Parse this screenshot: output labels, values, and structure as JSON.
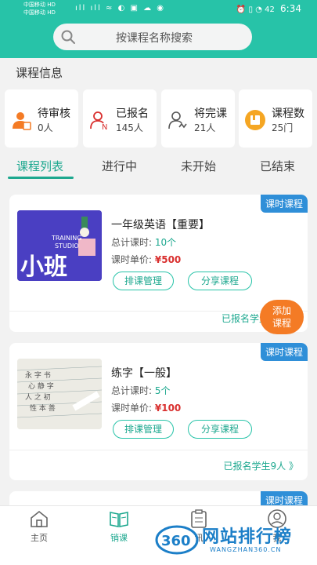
{
  "status": {
    "carrier1": "中国移动 HD",
    "carrier2": "中国移动 HD",
    "signal": "ıll ıll ≈ ◐ ▣ ☁ ◉",
    "right_icons": "⏰ ▯ ◔",
    "battery": "42",
    "time": "6:34"
  },
  "search": {
    "placeholder": "按课程名称搜索"
  },
  "section_title": "课程信息",
  "stats": [
    {
      "label": "待审核",
      "value": "0人",
      "icon": "person-review-icon",
      "color": "#f47b25"
    },
    {
      "label": "已报名",
      "value": "145人",
      "icon": "person-enrolled-icon",
      "color": "#d9302f"
    },
    {
      "label": "将完课",
      "value": "21人",
      "icon": "person-complete-icon",
      "color": "#555555"
    },
    {
      "label": "课程数",
      "value": "25门",
      "icon": "book-count-icon",
      "color": "#f5a623"
    }
  ],
  "tabs": [
    "课程列表",
    "进行中",
    "未开始",
    "已结束"
  ],
  "courses": [
    {
      "badge": "课时课程",
      "thumb_text": "小班",
      "thumb_sub1": "TRAINING",
      "thumb_sub2": "STUDIO",
      "title": "一年级英语【重要】",
      "lessons_label": "总计课时:",
      "lessons_value": "10个",
      "price_label": "课时单价:",
      "price_value": "¥500",
      "btn_schedule": "排课管理",
      "btn_share": "分享课程",
      "enrolled": "已报名学生"
    },
    {
      "badge": "课时课程",
      "title": "练字【一般】",
      "lessons_label": "总计课时:",
      "lessons_value": "5个",
      "price_label": "课时单价:",
      "price_value": "¥100",
      "btn_schedule": "排课管理",
      "btn_share": "分享课程",
      "enrolled": "已报名学生9人 》"
    },
    {
      "badge": "课时课程"
    }
  ],
  "float_add": {
    "line1": "添加",
    "line2": "课程"
  },
  "nav": [
    "主页",
    "销课",
    "讯",
    "我"
  ],
  "watermark": {
    "main": "网站排行榜",
    "sub": "WANGZHAN360.CN",
    "logo": "360"
  },
  "colors": {
    "primary": "#27c3a8",
    "accent": "#f47b25",
    "badge": "#2f8fd8",
    "price": "#d9302f"
  }
}
